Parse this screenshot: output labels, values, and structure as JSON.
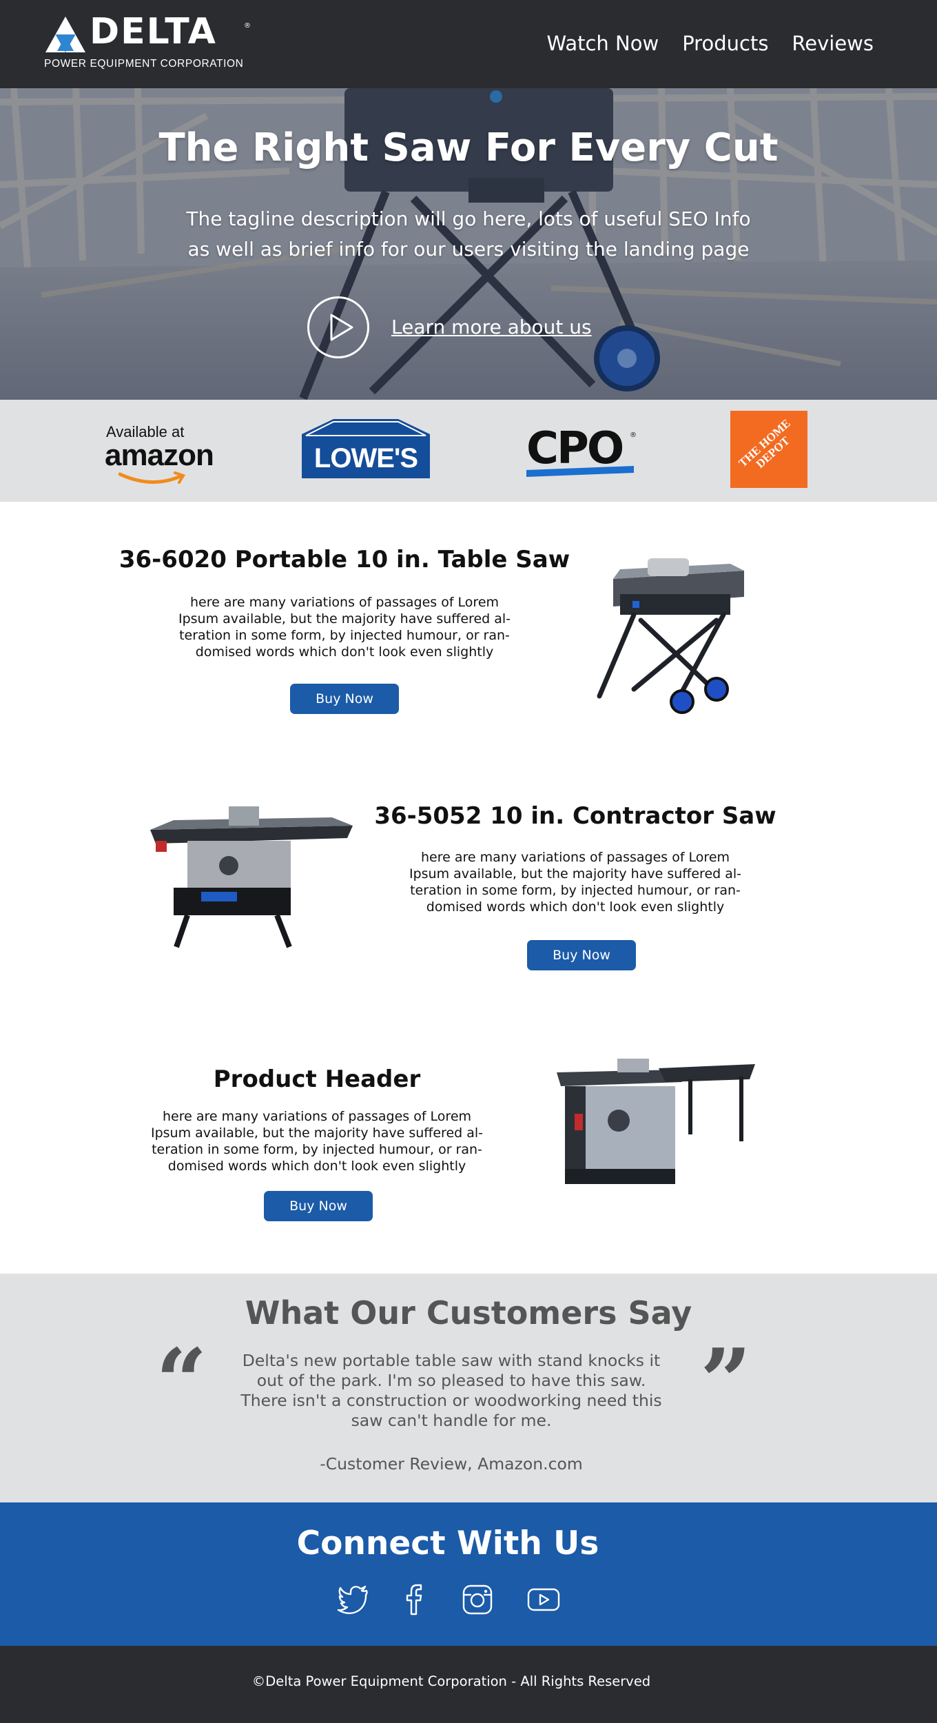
{
  "brand": {
    "name": "DELTA",
    "registered": "®",
    "subtitle": "POWER EQUIPMENT CORPORATION",
    "blue": "#1b5ba8",
    "dark": "#2a2c30"
  },
  "nav": {
    "items": [
      "Watch Now",
      "Products",
      "Reviews"
    ]
  },
  "hero": {
    "title": "The Right Saw For Every Cut",
    "tagline_line1": "The tagline description will go here, lots of useful SEO Info",
    "tagline_line2": "as well as brief info for our users visiting the landing page",
    "cta": "Learn more about us",
    "play_icon": "play-icon"
  },
  "retailers": {
    "amazon_prefix": "Available at",
    "amazon_name": "amazon",
    "lowes": "LOWE'S",
    "cpo": "CPO",
    "home_depot": "THE HOME DEPOT"
  },
  "products": [
    {
      "title": "36-6020 Portable 10 in. Table Saw",
      "desc": [
        "here are many variations of passages of Lorem",
        "Ipsum available, but the majority have suffered al-",
        "teration in some form, by injected humour, or ran-",
        "domised words which don't look even slightly"
      ],
      "button": "Buy Now"
    },
    {
      "title": "36-5052 10 in. Contractor Saw",
      "desc": [
        "here are many variations of passages of Lorem",
        "Ipsum available, but the majority have suffered al-",
        "teration in some form, by injected humour, or ran-",
        "domised words which don't look even slightly"
      ],
      "button": "Buy Now"
    },
    {
      "title": "Product Header",
      "desc": [
        "here are many variations of passages of Lorem",
        "Ipsum available, but the majority have suffered al-",
        "teration in some form, by injected humour, or ran-",
        "domised words which don't look even slightly"
      ],
      "button": "Buy Now"
    }
  ],
  "testimonial": {
    "heading": "What Our Customers Say",
    "open_quote": "“",
    "close_quote": "”",
    "lines": [
      "Delta's new portable table saw with stand knocks it",
      "out of the park. I'm so pleased to have this saw.",
      "There isn't a construction or woodworking need this",
      "saw can't handle for me."
    ],
    "source": "-Customer Review, Amazon.com"
  },
  "connect": {
    "heading": "Connect With Us",
    "icons": [
      "twitter-icon",
      "facebook-icon",
      "instagram-icon",
      "youtube-icon"
    ]
  },
  "footer": {
    "text": "©Delta Power Equipment Corporation - All Rights Reserved"
  }
}
